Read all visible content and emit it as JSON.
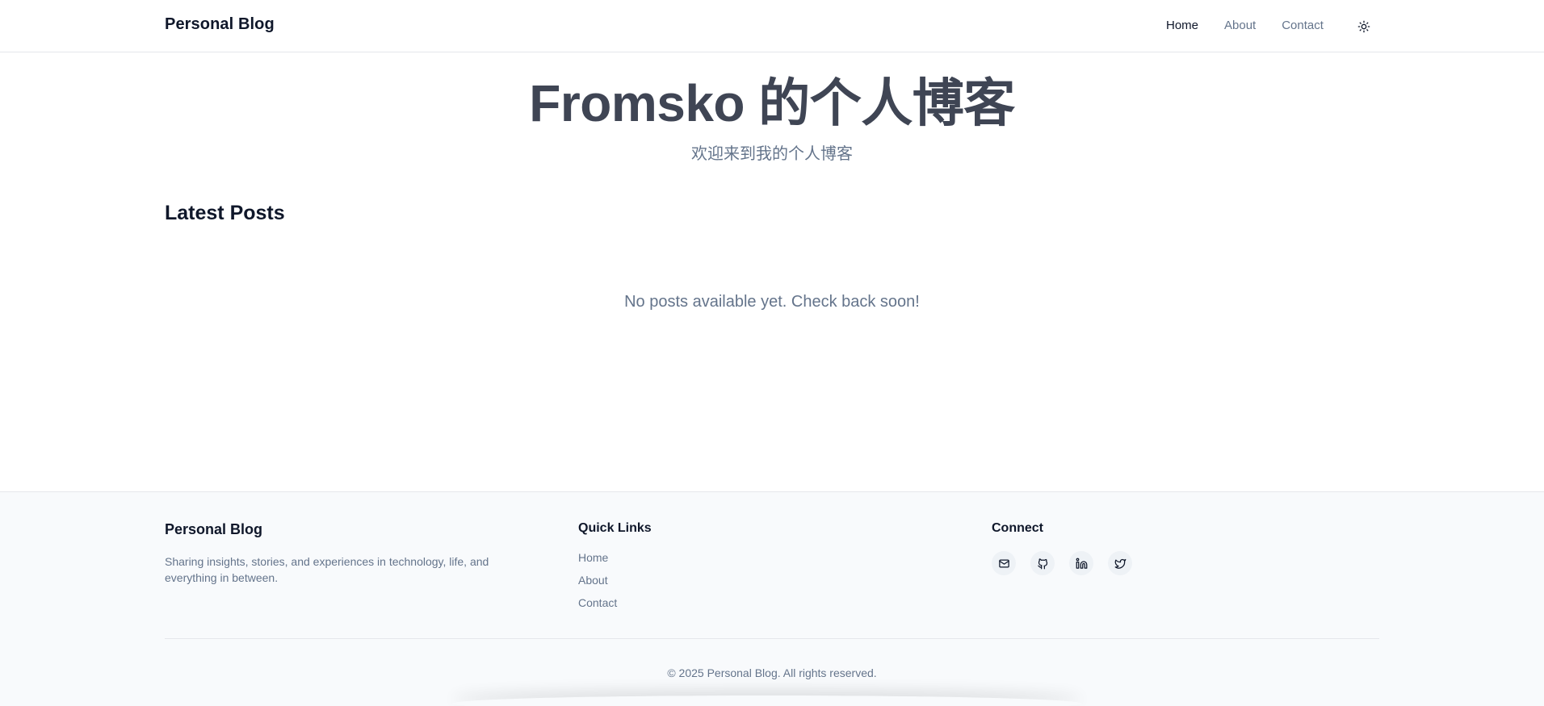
{
  "header": {
    "brand": "Personal Blog",
    "nav": [
      "Home",
      "About",
      "Contact"
    ],
    "active_nav": "Home",
    "theme_icon": "sun-icon"
  },
  "hero": {
    "title": "Fromsko 的个人博客",
    "subtitle": "欢迎来到我的个人博客"
  },
  "posts": {
    "section_title": "Latest Posts",
    "empty_message": "No posts available yet. Check back soon!"
  },
  "footer": {
    "brand": "Personal Blog",
    "description": "Sharing insights, stories, and experiences in technology, life, and everything in between.",
    "quick_links_title": "Quick Links",
    "quick_links": [
      "Home",
      "About",
      "Contact"
    ],
    "connect_title": "Connect",
    "social_icons": [
      "mail-icon",
      "github-icon",
      "linkedin-icon",
      "twitter-icon"
    ],
    "copyright": "© 2025 Personal Blog. All rights reserved."
  },
  "colors": {
    "text_primary": "#0f172a",
    "text_muted": "#64748b",
    "hero_title": "#3f4554",
    "footer_bg": "#f8fafc",
    "border": "#e5e7eb"
  }
}
